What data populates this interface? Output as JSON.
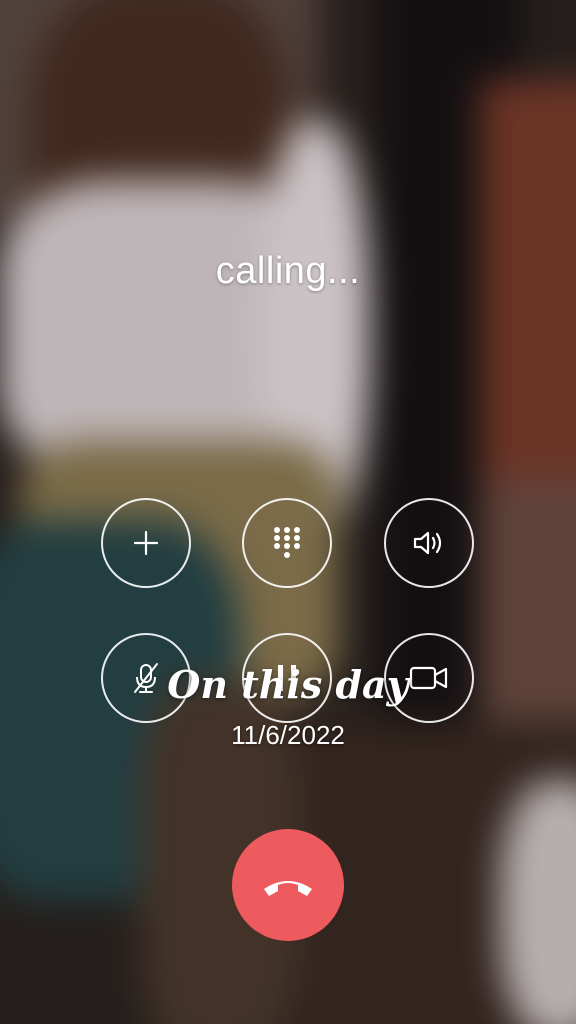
{
  "call": {
    "status": "calling..."
  },
  "memory": {
    "title": "On this day",
    "date": "11/6/2022"
  },
  "buttons": {
    "add_call": "plus-icon",
    "keypad": "keypad-icon",
    "speaker": "speaker-icon",
    "mute": "mute-icon",
    "hold": "pause-icon",
    "video": "video-camera-icon"
  },
  "colors": {
    "end_call": "#ee5b5e",
    "foreground": "#ffffff"
  }
}
